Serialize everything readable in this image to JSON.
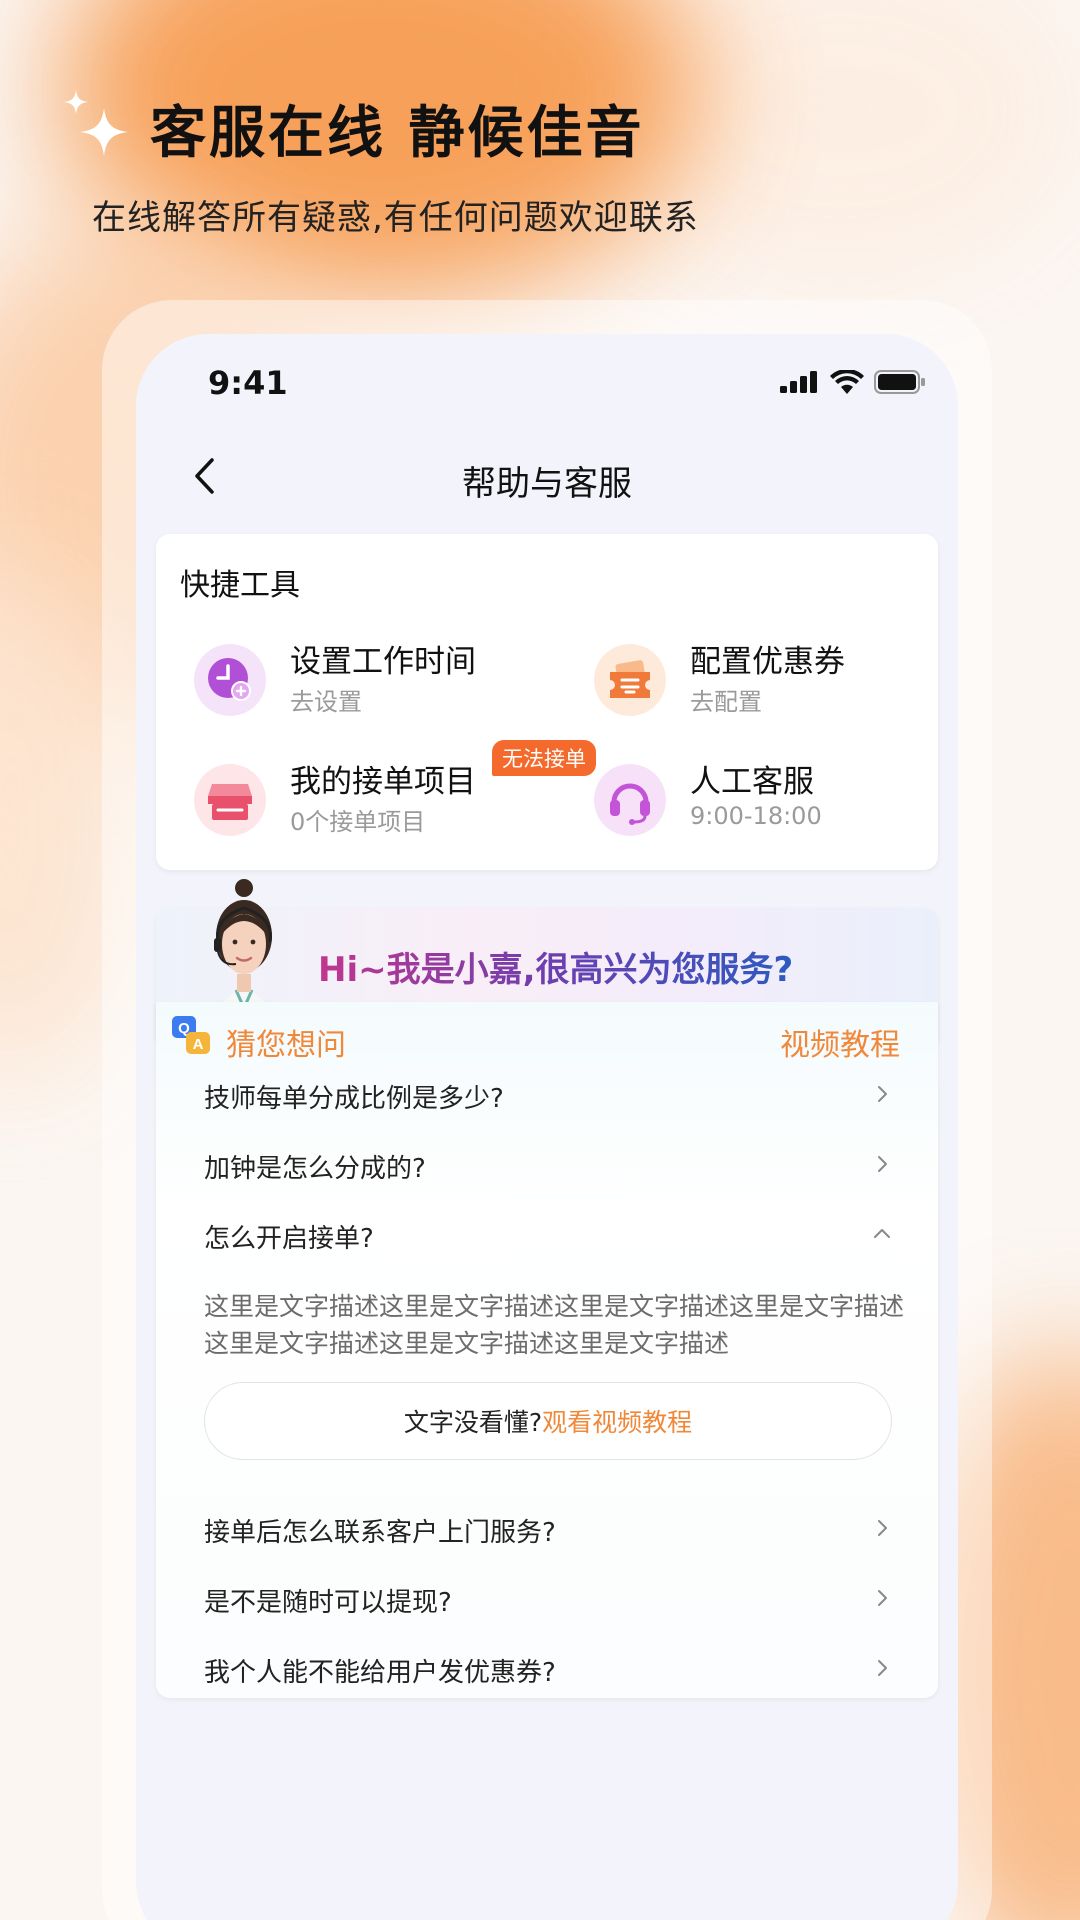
{
  "header": {
    "title": "客服在线 静候佳音",
    "subtitle": "在线解答所有疑惑,有任何问题欢迎联系"
  },
  "status_bar": {
    "time": "9:41"
  },
  "nav": {
    "title": "帮助与客服"
  },
  "quick_tools": {
    "title": "快捷工具",
    "items": [
      {
        "name": "设置工作时间",
        "sub": "去设置",
        "icon": "clock-plus-icon"
      },
      {
        "name": "配置优惠券",
        "sub": "去配置",
        "icon": "coupon-icon"
      },
      {
        "name": "我的接单项目",
        "sub": "0个接单项目",
        "icon": "store-icon",
        "badge": "无法接单"
      },
      {
        "name": "人工客服",
        "sub": "9:00-18:00",
        "icon": "headset-icon"
      }
    ]
  },
  "assistant": {
    "greeting": "Hi~我是小嘉,很高兴为您服务?"
  },
  "faq": {
    "title": "猜您想问",
    "video_link": "视频教程",
    "items": [
      {
        "q": "技师每单分成比例是多少?"
      },
      {
        "q": "加钟是怎么分成的?"
      },
      {
        "q": "怎么开启接单?",
        "expanded": true
      },
      {
        "q": "接单后怎么联系客户上门服务?"
      },
      {
        "q": "是不是随时可以提现?"
      },
      {
        "q": "我个人能不能给用户发优惠券?"
      }
    ],
    "answer": "这里是文字描述这里是文字描述这里是文字描述这里是文字描述这里是文字描述这里是文字描述这里是文字描述",
    "video_btn_prefix": "文字没看懂?",
    "video_btn_accent": "观看视频教程"
  },
  "colors": {
    "accent_orange": "#f0883a",
    "badge_red": "#f46a2c",
    "purple": "#b14fd6",
    "pink": "#e8506c"
  }
}
